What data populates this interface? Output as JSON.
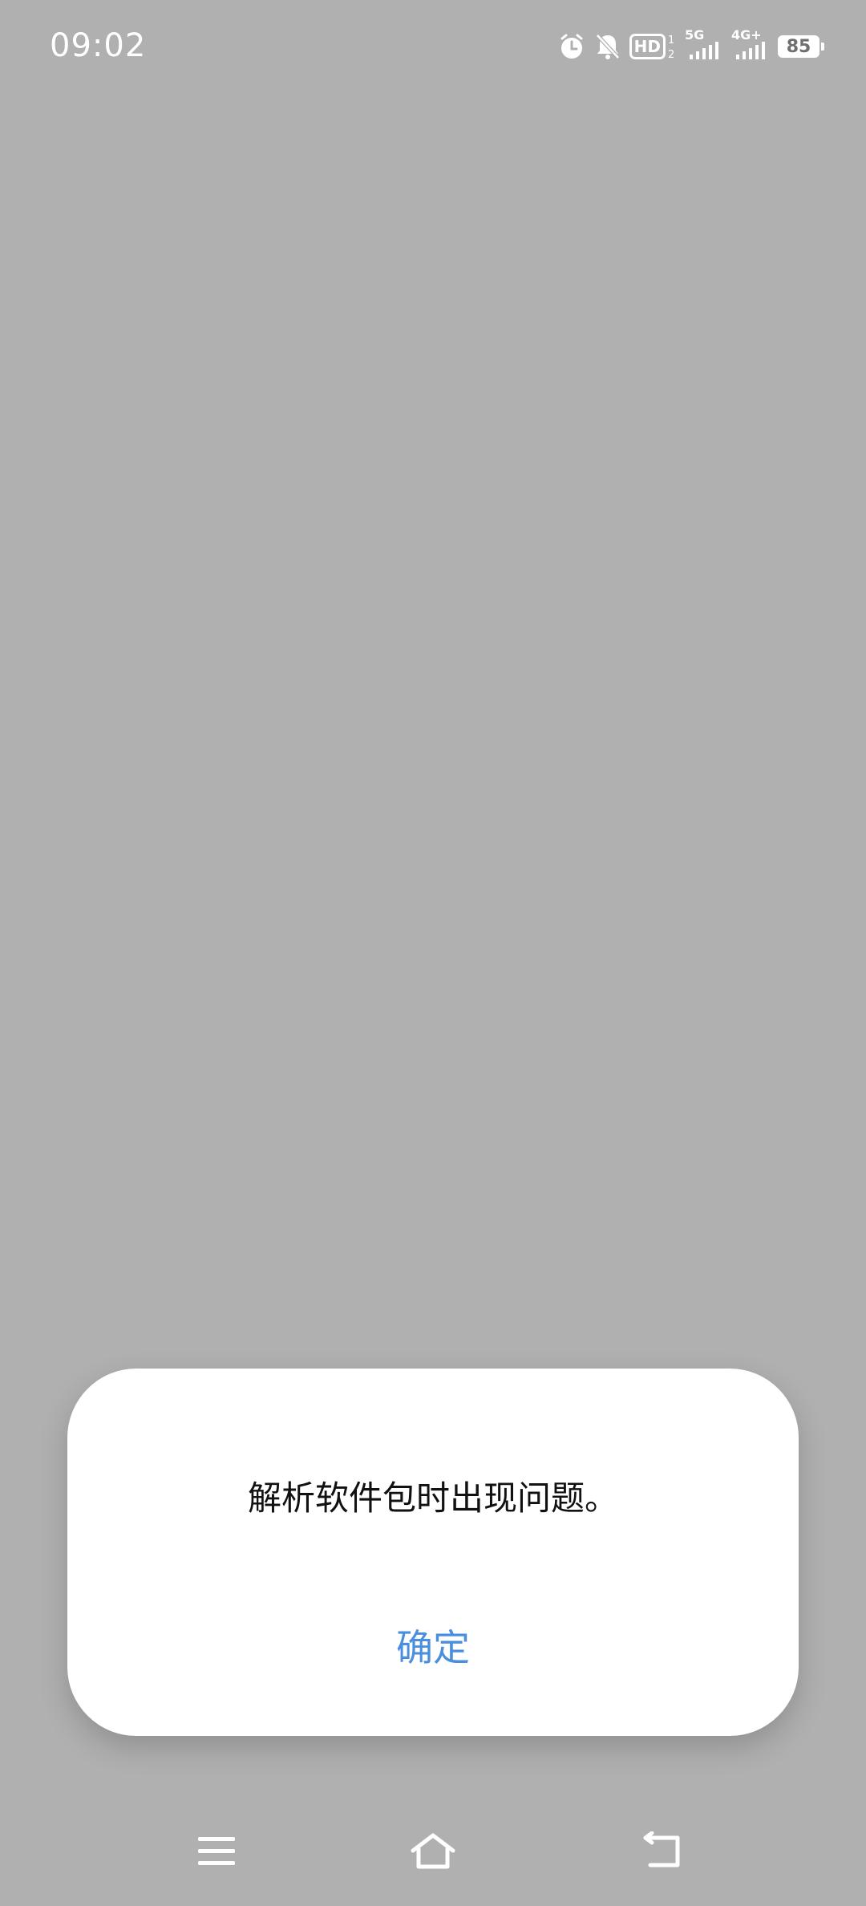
{
  "status_bar": {
    "time": "09:02",
    "icons": [
      "alarm-icon",
      "bell-muted-icon",
      "hd-icon",
      "5g-signal-icon",
      "4g-signal-icon",
      "battery-icon"
    ],
    "hd_label": "HD",
    "network_1": "5G",
    "network_2": "4G+",
    "battery_level": "85"
  },
  "dialog": {
    "message": "解析软件包时出现问题。",
    "confirm_label": "确定",
    "accent_color": "#4a8ede"
  },
  "nav_bar": {
    "icons": [
      "menu-icon",
      "home-icon",
      "back-icon"
    ]
  }
}
